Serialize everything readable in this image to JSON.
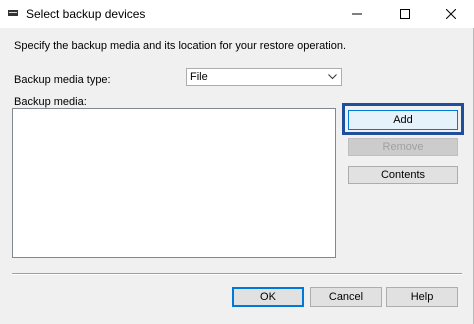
{
  "window": {
    "title": "Select backup devices",
    "icon": "backup-device-icon"
  },
  "instruction": "Specify the backup media and its location for your restore operation.",
  "media_type": {
    "label": "Backup media type:",
    "selected": "File"
  },
  "media_list": {
    "label": "Backup media:",
    "items": []
  },
  "side_buttons": {
    "add": "Add",
    "remove": "Remove",
    "contents": "Contents"
  },
  "footer_buttons": {
    "ok": "OK",
    "cancel": "Cancel",
    "help": "Help"
  },
  "colors": {
    "focus_highlight": "#1f4e9a",
    "default_button_border": "#0078d7"
  }
}
